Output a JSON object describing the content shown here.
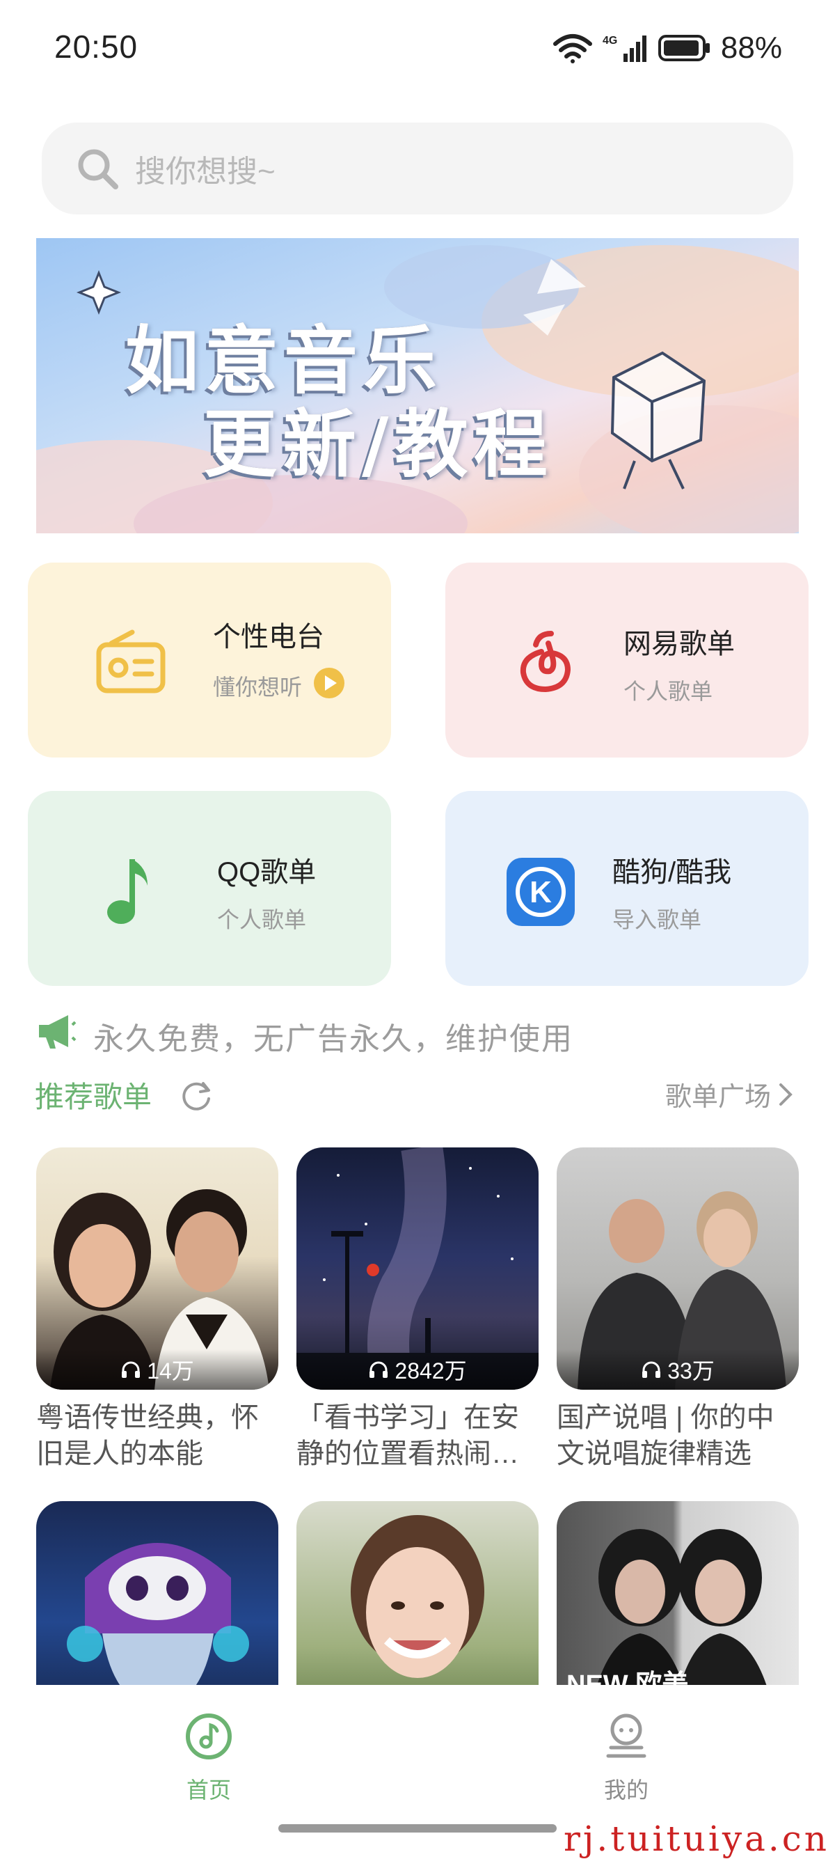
{
  "status": {
    "time": "20:50",
    "battery": "88%",
    "network": "4G"
  },
  "search": {
    "placeholder": "搜你想搜~"
  },
  "banner": {
    "line1": "如意音乐",
    "line2": "更新/教程"
  },
  "cards": [
    {
      "title": "个性电台",
      "subtitle": "懂你想听",
      "icon": "radio-icon"
    },
    {
      "title": "网易歌单",
      "subtitle": "个人歌单",
      "icon": "netease-icon"
    },
    {
      "title": "QQ歌单",
      "subtitle": "个人歌单",
      "icon": "music-note-icon"
    },
    {
      "title": "酷狗/酷我",
      "subtitle": "导入歌单",
      "icon": "kugou-icon"
    }
  ],
  "notice": {
    "text": "永久免费，无广告永久，维护使用"
  },
  "section": {
    "title": "推荐歌单",
    "more": "歌单广场"
  },
  "playlists": [
    {
      "plays": "14万",
      "caption": "粤语传世经典，怀旧是人的本能"
    },
    {
      "plays": "2842万",
      "caption": "「看书学习」在安静的位置看热闹…"
    },
    {
      "plays": "33万",
      "caption": "国产说唱 | 你的中文说唱旋律精选"
    },
    {
      "plays": "",
      "caption": ""
    },
    {
      "plays": "",
      "caption": ""
    },
    {
      "plays": "",
      "caption": "",
      "badge": "NEW 欧美"
    }
  ],
  "nav": {
    "home": "首页",
    "mine": "我的"
  },
  "watermark": "rj.tuituiya.cn",
  "colors": {
    "accent": "#6cb372",
    "netease": "#d8383a",
    "kugou": "#2b7de0",
    "radio": "#f0c048"
  }
}
